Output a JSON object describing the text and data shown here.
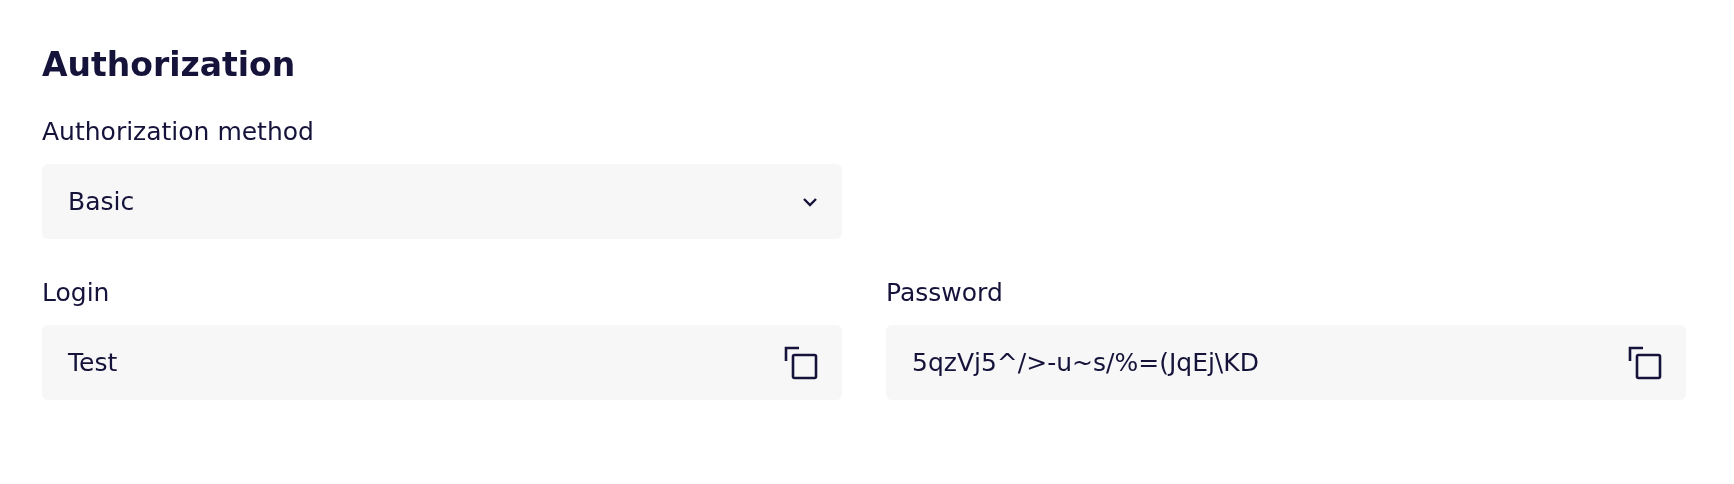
{
  "heading": "Authorization",
  "method": {
    "label": "Authorization method",
    "value": "Basic"
  },
  "credentials": [
    {
      "label": "Login",
      "value": "Test"
    },
    {
      "label": "Password",
      "value": "5qzVj5^/>-u~s/%=(JqEj\\KD"
    }
  ]
}
